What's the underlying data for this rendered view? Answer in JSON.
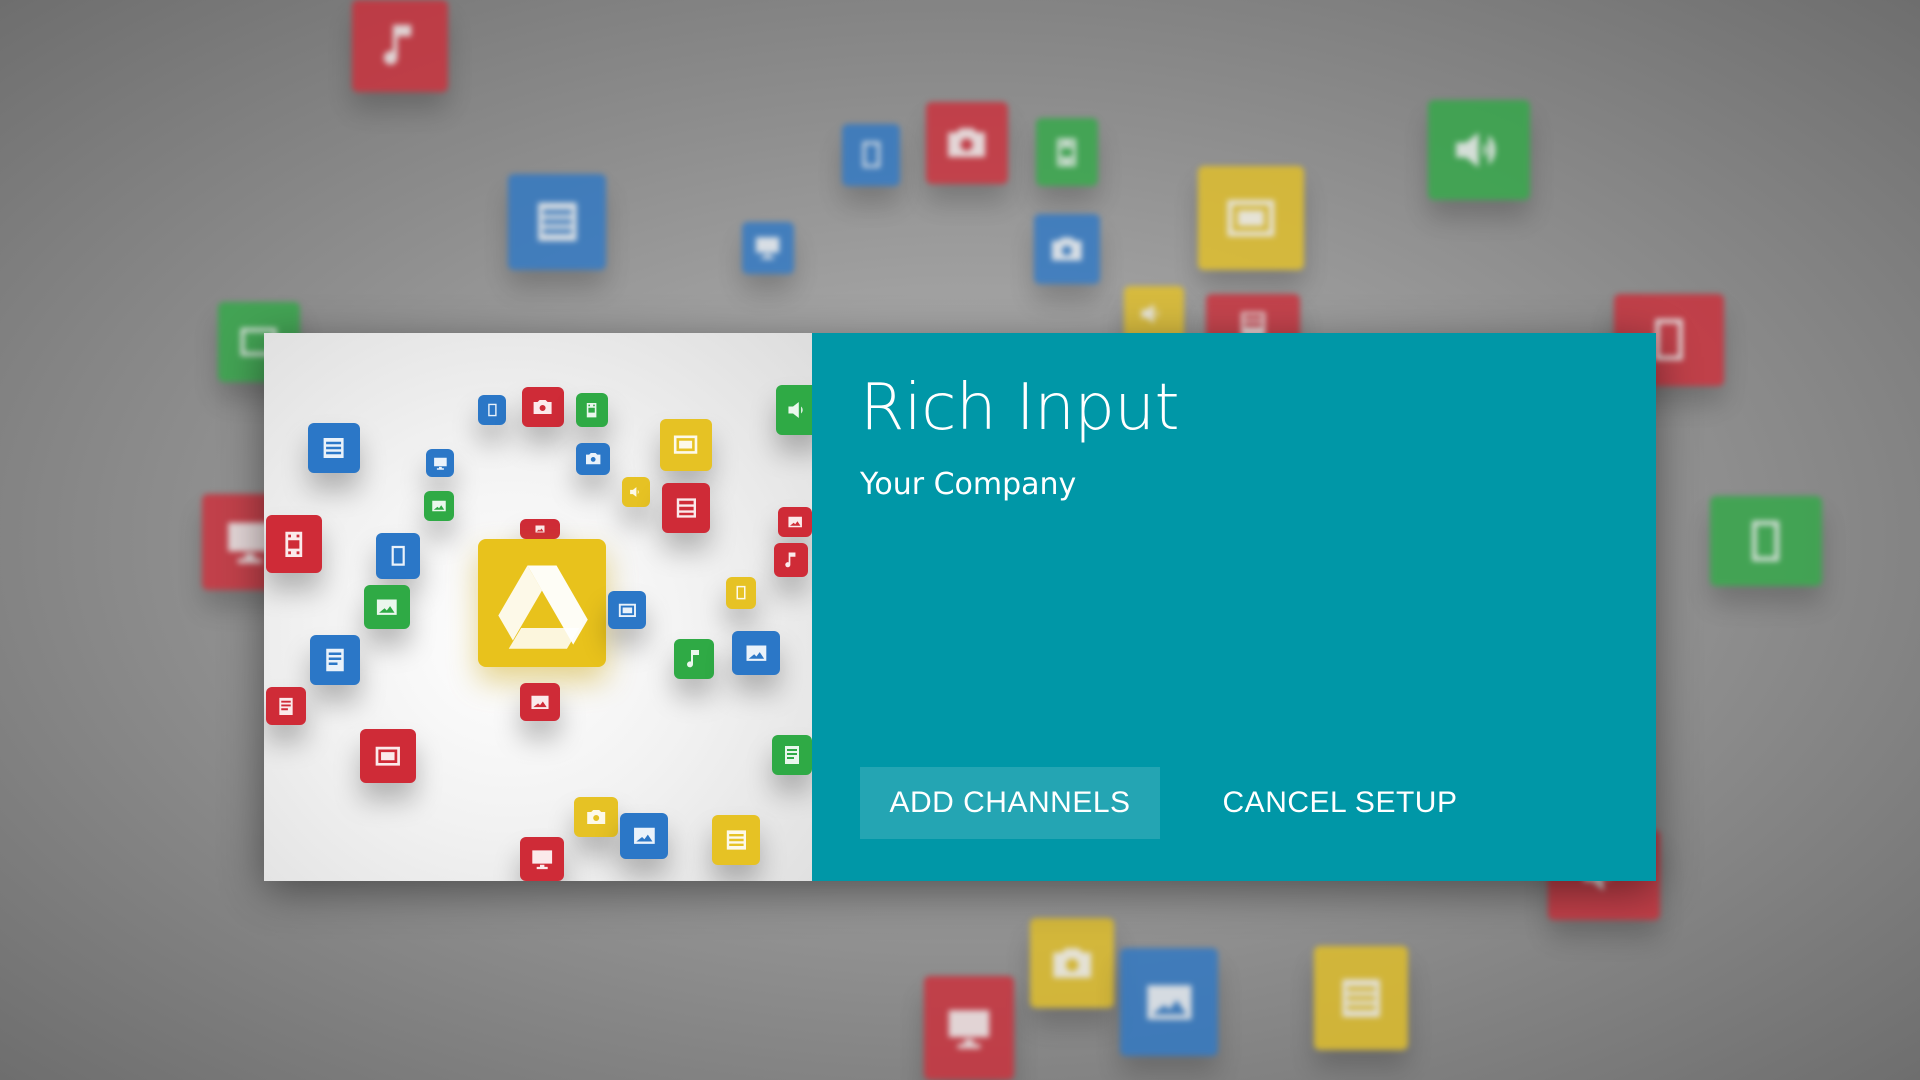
{
  "dialog": {
    "title": "Rich Input",
    "subtitle": "Your Company",
    "primary_action": "ADD CHANNELS",
    "secondary_action": "CANCEL SETUP"
  },
  "colors": {
    "panel": "#0097a7",
    "red": "#cf2b37",
    "blue": "#2b77c7",
    "green": "#2faa45",
    "yellow": "#e6c224"
  },
  "art": {
    "logo_icon": "drive-logo-icon"
  }
}
